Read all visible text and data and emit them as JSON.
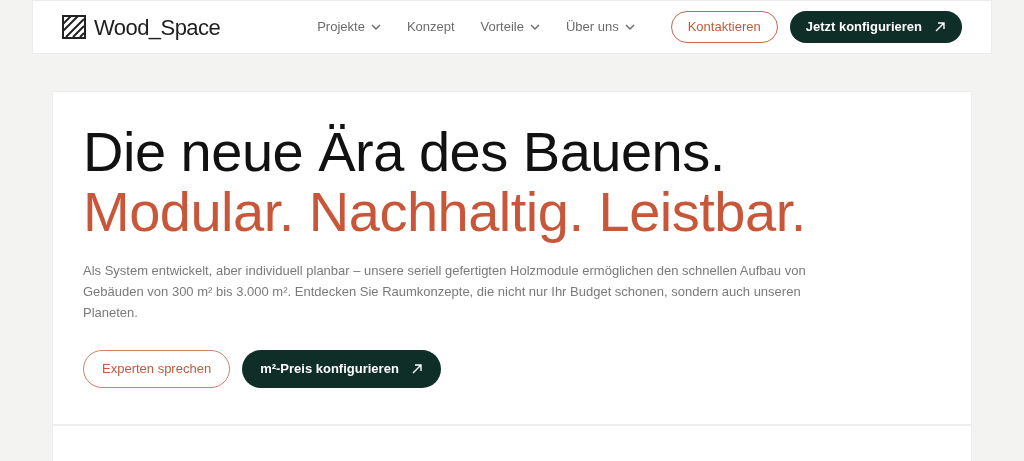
{
  "header": {
    "logo": "Wood_Space",
    "nav": [
      {
        "label": "Projekte",
        "has_menu": true
      },
      {
        "label": "Konzept",
        "has_menu": false
      },
      {
        "label": "Vorteile",
        "has_menu": true
      },
      {
        "label": "Über uns",
        "has_menu": true
      }
    ],
    "contact_button": "Kontaktieren",
    "configure_button": "Jetzt konfigurieren"
  },
  "hero": {
    "headline": "Die neue Ära des Bauens.",
    "subheadline": "Modular. Nachhaltig. Leistbar.",
    "description": "Als System entwickelt, aber individuell planbar – unsere seriell gefertigten Holzmodule ermöglichen den schnellen Aufbau von Gebäuden von 300 m² bis 3.000 m². Entdecken Sie Raumkonzepte, die nicht nur Ihr Budget schonen, sondern auch unseren Planeten.",
    "secondary_button": "Experten sprechen",
    "primary_button": "m²-Preis konfigurieren"
  }
}
